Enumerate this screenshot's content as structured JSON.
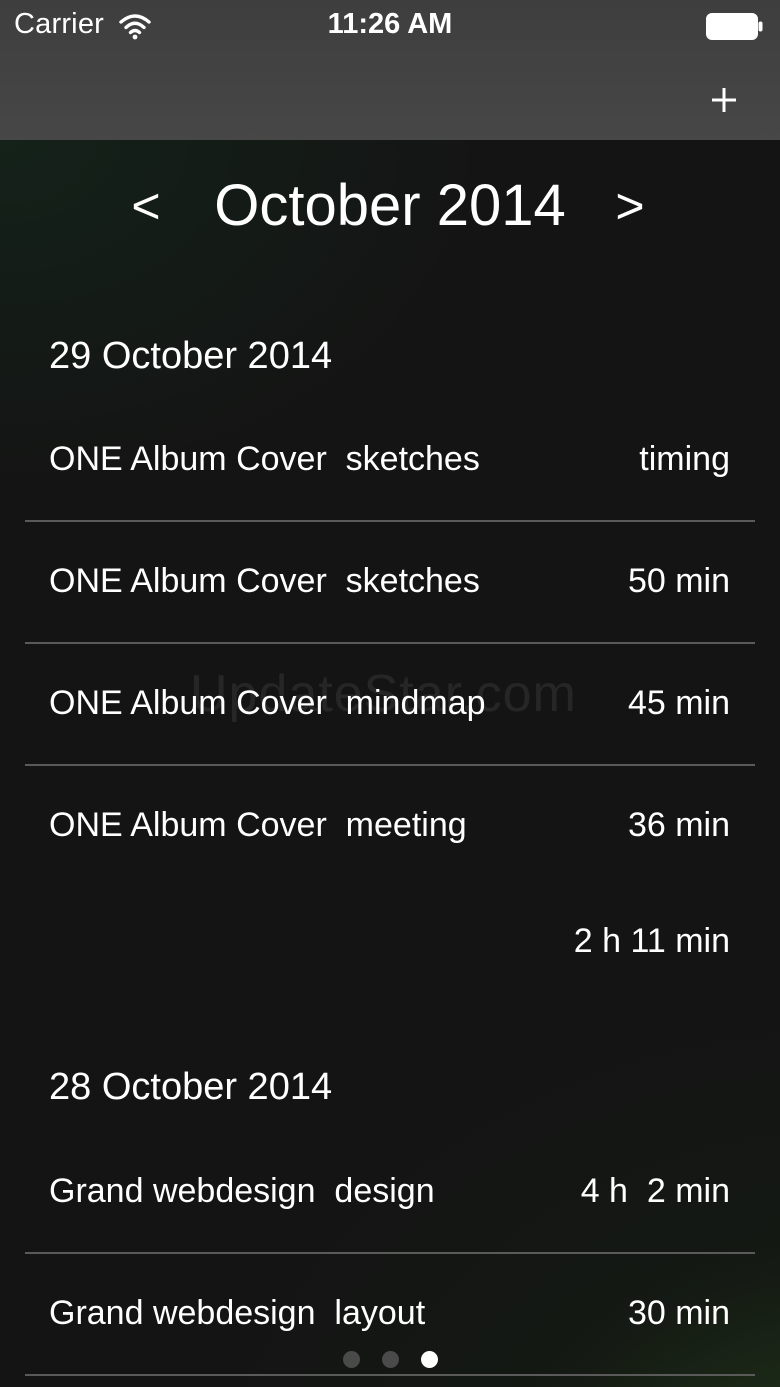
{
  "status_bar": {
    "carrier": "Carrier",
    "time": "11:26 AM",
    "icons": [
      "wifi-icon",
      "battery-icon"
    ]
  },
  "nav": {
    "add_label": "+",
    "add_icon": "plus-icon"
  },
  "month_nav": {
    "prev": "<",
    "title": "October 2014",
    "next": ">"
  },
  "sections": [
    {
      "date": "29 October 2014",
      "entries": [
        {
          "project": "ONE Album Cover",
          "task": "sketches",
          "duration": "timing"
        },
        {
          "project": "ONE Album Cover",
          "task": "sketches",
          "duration": "50 min"
        },
        {
          "project": "ONE Album Cover",
          "task": "mindmap",
          "duration": "45 min"
        },
        {
          "project": "ONE Album Cover",
          "task": "meeting",
          "duration": "36 min"
        }
      ],
      "total": "2 h 11 min"
    },
    {
      "date": "28 October 2014",
      "entries": [
        {
          "project": "Grand webdesign",
          "task": "design",
          "duration": "4 h  2 min"
        },
        {
          "project": "Grand webdesign",
          "task": "layout",
          "duration": "30 min"
        }
      ]
    }
  ],
  "watermark": "UpdateStar.com",
  "page_control": {
    "count": 3,
    "current": 3
  },
  "colors": {
    "nav_bar": "#454545",
    "background": "#141414",
    "text": "#ffffff",
    "divider": "#5a5a5a",
    "dot_inactive": "#4a4a4a"
  }
}
